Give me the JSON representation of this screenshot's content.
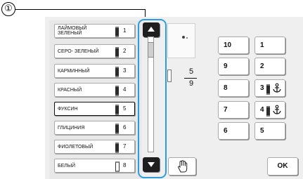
{
  "callout": {
    "label": "①"
  },
  "thread_list": {
    "items": [
      {
        "name": "ЛАЙМОВЫЙ ЗЕЛЕНЫЙ",
        "number": "1",
        "spool": "dark"
      },
      {
        "name": "СЕРО- ЗЕЛЕНЫЙ",
        "number": "2",
        "spool": "dark"
      },
      {
        "name": "КАРМИННЫЙ",
        "number": "3",
        "spool": "dark"
      },
      {
        "name": "КРАСНЫЙ",
        "number": "4",
        "spool": "dark"
      },
      {
        "name": "ФУКСИН",
        "number": "5",
        "spool": "dark",
        "selected": true
      },
      {
        "name": "ГЛИЦИНИЯ",
        "number": "6",
        "spool": "dark"
      },
      {
        "name": "ФИОЛЕТОВЫЙ",
        "number": "7",
        "spool": "dark"
      },
      {
        "name": "БЕЛЫЙ",
        "number": "8",
        "spool": "white"
      }
    ]
  },
  "scrollbar": {
    "highlight_color": "#2a9de0",
    "icon_up": "triangle-up-icon",
    "icon_down": "triangle-down-icon"
  },
  "progress": {
    "current": "5",
    "total": "9"
  },
  "needle_keys": {
    "left_column": [
      "10",
      "9",
      "8",
      "7",
      "6"
    ],
    "right_column": [
      "1",
      "2",
      "3",
      "4",
      "5"
    ],
    "anchored": [
      "3",
      "4"
    ]
  },
  "buttons": {
    "ok_label": "OK",
    "hand_icon": "hand-pointer-icon"
  }
}
